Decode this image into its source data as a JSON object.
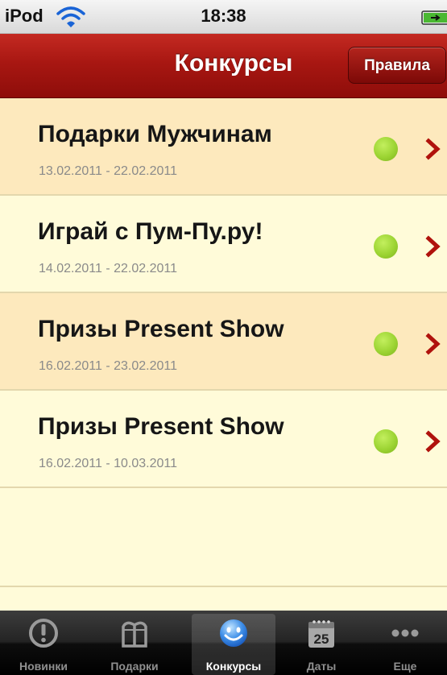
{
  "status_bar": {
    "carrier": "iPod",
    "time": "18:38"
  },
  "nav": {
    "title": "Конкурсы",
    "right_button": "Правила"
  },
  "contests": [
    {
      "title": "Подарки Мужчинам",
      "dates": "13.02.2011 - 22.02.2011",
      "status": "active"
    },
    {
      "title": "Играй с Пум-Пу.ру!",
      "dates": "14.02.2011 - 22.02.2011",
      "status": "active"
    },
    {
      "title": "Призы Present Show",
      "dates": "16.02.2011 - 23.02.2011",
      "status": "active"
    },
    {
      "title": "Призы Present Show",
      "dates": "16.02.2011 - 10.03.2011",
      "status": "active"
    }
  ],
  "tabs": [
    {
      "label": "Новинки",
      "icon": "exclamation-icon"
    },
    {
      "label": "Подарки",
      "icon": "gift-icon"
    },
    {
      "label": "Конкурсы",
      "icon": "smiley-icon",
      "selected": true
    },
    {
      "label": "Даты",
      "icon": "calendar-icon",
      "calendar_day": "25"
    },
    {
      "label": "Еще",
      "icon": "more-icon"
    }
  ],
  "colors": {
    "nav_red": "#a81712",
    "row_alt": "#fde9bd",
    "row_plain": "#fffbd9",
    "status_green": "#9cd433",
    "chevron_red": "#b0120c",
    "tab_selected_blue": "#3f8fe8"
  }
}
